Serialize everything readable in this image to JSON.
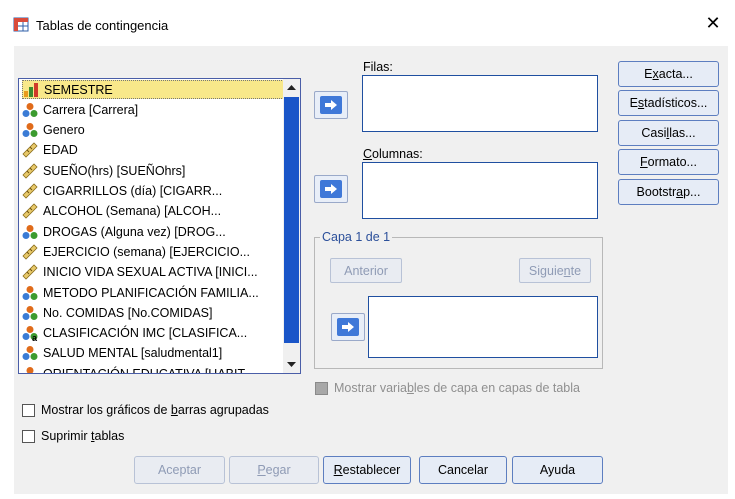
{
  "window": {
    "title": "Tablas de contingencia",
    "close_glyph": "✕"
  },
  "variables": [
    {
      "label": "SEMESTRE",
      "icon": "scale-icon",
      "selected": true
    },
    {
      "label": "Carrera  [Carrera]",
      "icon": "nominal-icon"
    },
    {
      "label": "Genero",
      "icon": "nominal-icon"
    },
    {
      "label": "EDAD",
      "icon": "ruler-icon"
    },
    {
      "label": "SUEÑO(hrs) [SUEÑOhrs]",
      "icon": "ruler-icon"
    },
    {
      "label": "CIGARRILLOS          (día) [CIGARR...",
      "icon": "ruler-icon"
    },
    {
      "label": "ALCOHOL        (Semana) [ALCOH...",
      "icon": "ruler-icon"
    },
    {
      "label": "DROGAS        (Alguna vez) [DROG...",
      "icon": "nominal-icon"
    },
    {
      "label": "EJERCICIO (semana) [EJERCICIO...",
      "icon": "ruler-icon"
    },
    {
      "label": "INICIO VIDA SEXUAL ACTIVA  [INICI...",
      "icon": "ruler-icon"
    },
    {
      "label": "METODO PLANIFICACIÓN FAMILIA...",
      "icon": "nominal-icon"
    },
    {
      "label": "No. COMIDAS [No.COMIDAS]",
      "icon": "nominal-icon"
    },
    {
      "label": "CLASIFICACIÓN   IMC [CLASIFICA...",
      "icon": "nominal-string-icon"
    },
    {
      "label": "SALUD MENTAL [saludmental1]",
      "icon": "nominal-icon"
    },
    {
      "label": "ORIENTACIÓN EDUCATIVA [HABIT...",
      "icon": "nominal-icon"
    }
  ],
  "filas": {
    "label_pre": "",
    "label_u": "",
    "label_post": "Filas:"
  },
  "columnas": {
    "label_pre": "",
    "label_u": "C",
    "label_post": "olumnas:"
  },
  "capa": {
    "title": "Capa 1 de 1",
    "anterior": "Anterior",
    "siguiente_pre": "Siguie",
    "siguiente_u": "n",
    "siguiente_post": "te"
  },
  "mostrar_capa": {
    "pre": "Mostrar varia",
    "u": "b",
    "post": "les de capa en capas de tabla"
  },
  "right_buttons": [
    {
      "name": "exacta-button",
      "pre": "E",
      "u": "x",
      "post": "acta..."
    },
    {
      "name": "estadisticos-button",
      "pre": "E",
      "u": "s",
      "post": "tadísticos..."
    },
    {
      "name": "casillas-button",
      "pre": "Casi",
      "u": "l",
      "post": "las..."
    },
    {
      "name": "formato-button",
      "pre": "",
      "u": "F",
      "post": "ormato..."
    },
    {
      "name": "bootstrap-button",
      "pre": "Bootstr",
      "u": "a",
      "post": "p..."
    }
  ],
  "checks": {
    "barras": {
      "pre": "Mostrar los gráficos de ",
      "u": "b",
      "post": "arras agrupadas"
    },
    "suprimir": {
      "pre": "Suprimir ",
      "u": "t",
      "post": "ablas"
    }
  },
  "bottom_buttons": [
    {
      "name": "aceptar-button",
      "pre": "Aceptar",
      "u": "",
      "post": "",
      "enabled": false
    },
    {
      "name": "pegar-button",
      "pre": "",
      "u": "P",
      "post": "egar",
      "enabled": false
    },
    {
      "name": "restablecer-button",
      "pre": "",
      "u": "R",
      "post": "establecer",
      "enabled": true
    },
    {
      "name": "cancelar-button",
      "pre": "Cancelar",
      "u": "",
      "post": "",
      "enabled": true
    },
    {
      "name": "ayuda-button",
      "pre": "Ayuda",
      "u": "",
      "post": "",
      "enabled": true
    }
  ],
  "colors": {
    "accent": "#1a55c8",
    "selection": "#f8e88a",
    "arrow": "#3f78d8"
  }
}
